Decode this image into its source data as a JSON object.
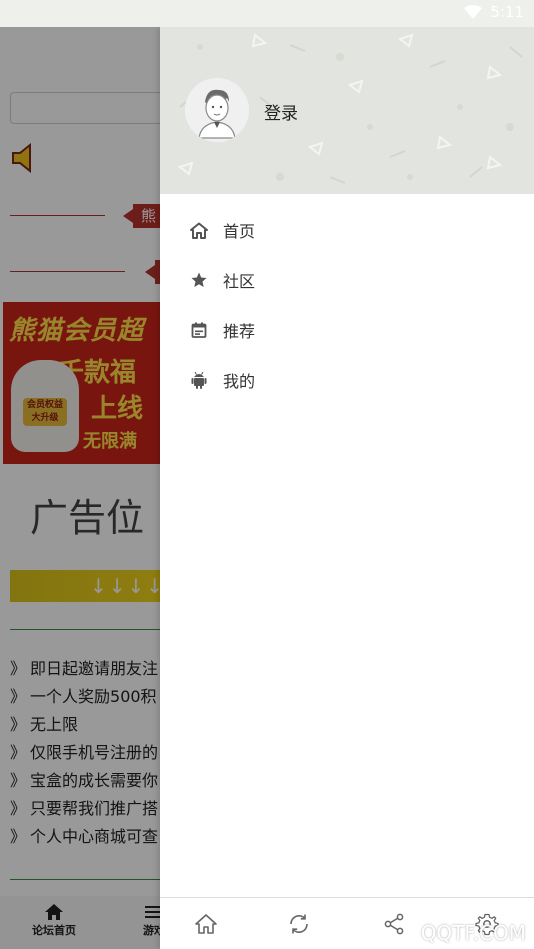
{
  "status_bar": {
    "time": "5:11"
  },
  "background": {
    "divider_tag_1": "熊",
    "divider_tag_2": "",
    "banner": {
      "line1": "熊猫会员超",
      "line2": "千款福",
      "line3": "上线",
      "line4": "无限满",
      "cat_tag": "会员权益大升级"
    },
    "ad_text": "广告位",
    "arrows": "↓↓↓↓",
    "list": [
      "即日起邀请朋友注",
      "一个人奖励500积",
      "无上限",
      "仅限手机号注册的",
      "宝盒的成长需要你",
      "只要帮我们推广搭",
      "个人中心商城可查"
    ],
    "list_marker": "》",
    "bottom_nav": [
      {
        "label": "论坛首页",
        "icon": "home-icon"
      },
      {
        "label": "游戏",
        "icon": "menu-icon"
      }
    ]
  },
  "drawer": {
    "login_label": "登录",
    "menu": [
      {
        "label": "首页",
        "icon": "home-icon"
      },
      {
        "label": "社区",
        "icon": "star-icon"
      },
      {
        "label": "推荐",
        "icon": "calendar-icon"
      },
      {
        "label": "我的",
        "icon": "android-icon"
      }
    ],
    "bottom_icons": [
      "home-icon",
      "refresh-icon",
      "share-icon",
      "settings-icon"
    ]
  },
  "watermark": "QQTF.COM",
  "colors": {
    "header_bg": "#e2e5df",
    "accent_red": "#b8322c",
    "divider_green": "#3c8a3c",
    "icon_gray": "#555555"
  }
}
